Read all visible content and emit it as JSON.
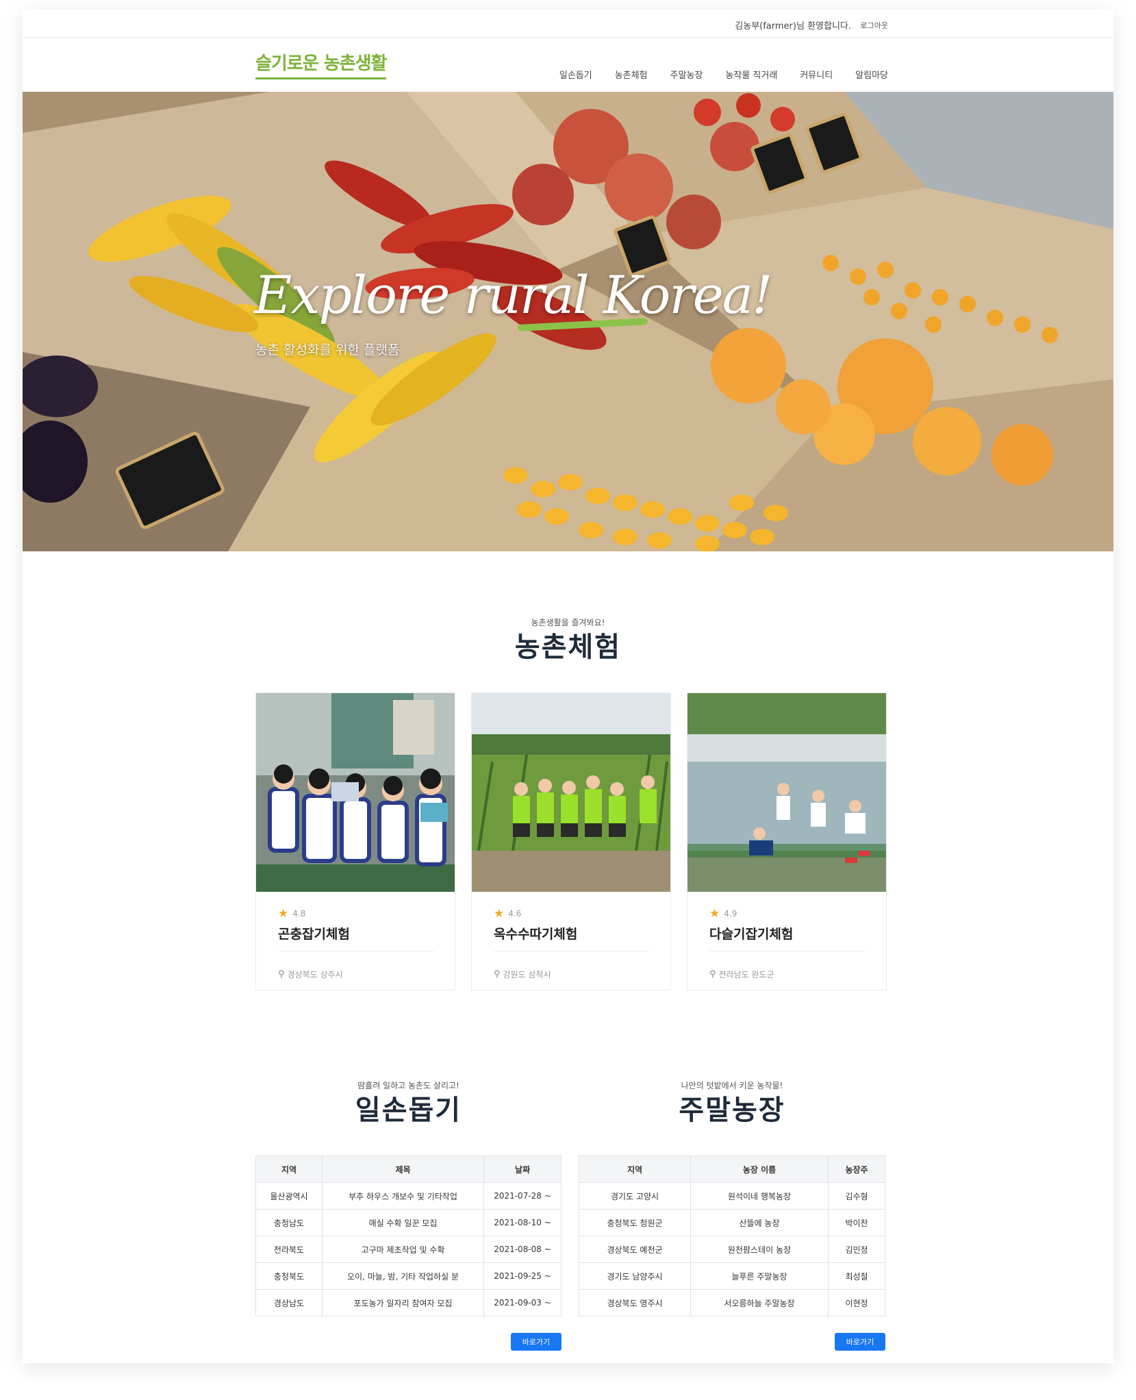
{
  "topbar": {
    "welcome": "김농부(farmer)님 환영합니다.",
    "logout": "로그아웃"
  },
  "header": {
    "logo": "슬기로운 농촌생활",
    "nav": [
      "일손돕기",
      "농촌체험",
      "주말농장",
      "농작물 직거래",
      "커뮤니티",
      "알림마당"
    ]
  },
  "hero": {
    "title": "Explore rural Korea!",
    "subtitle": "농촌 활성화를 위한 플랫폼"
  },
  "experience": {
    "eyebrow": "농촌생활을 즐겨봐요!",
    "heading": "농촌체험",
    "cards": [
      {
        "rating": "4.8",
        "title": "곤충잡기체험",
        "location": "경상북도 상주시"
      },
      {
        "rating": "4.6",
        "title": "옥수수따기체험",
        "location": "강원도 삼척시"
      },
      {
        "rating": "4.9",
        "title": "다슬기잡기체험",
        "location": "전라남도 완도군"
      }
    ]
  },
  "help": {
    "eyebrow": "땀흘려 일하고 농촌도 살리고!",
    "heading": "일손돕기",
    "columns": [
      "지역",
      "제목",
      "날짜"
    ],
    "rows": [
      [
        "울산광역시",
        "부추 하우스 개보수 및 기타작업",
        "2021-07-28 ~"
      ],
      [
        "충청남도",
        "매실 수확 일꾼 모집",
        "2021-08-10 ~"
      ],
      [
        "전라북도",
        "고구마 제초작업 및 수확",
        "2021-08-08 ~"
      ],
      [
        "충청북도",
        "오이, 마늘, 밤, 기타 작업하실 분",
        "2021-09-25 ~"
      ],
      [
        "경상남도",
        "포도농가 일자리 참여자 모집",
        "2021-09-03 ~"
      ]
    ],
    "button": "바로가기"
  },
  "weekend": {
    "eyebrow": "나만의 텃밭에서 키운 농작물!",
    "heading": "주말농장",
    "columns": [
      "지역",
      "농장 이름",
      "농장주"
    ],
    "rows": [
      [
        "경기도 고양시",
        "원석이네 행복농장",
        "김수형"
      ],
      [
        "충청북도 청원군",
        "산뜰에 농장",
        "박이찬"
      ],
      [
        "경상북도 예천군",
        "원천팜스테이 농장",
        "김민정"
      ],
      [
        "경기도 남양주시",
        "늘푸른 주말농장",
        "최성철"
      ],
      [
        "경상북도 영주시",
        "서오릉하늘 주말농장",
        "이현정"
      ]
    ],
    "button": "바로가기"
  }
}
